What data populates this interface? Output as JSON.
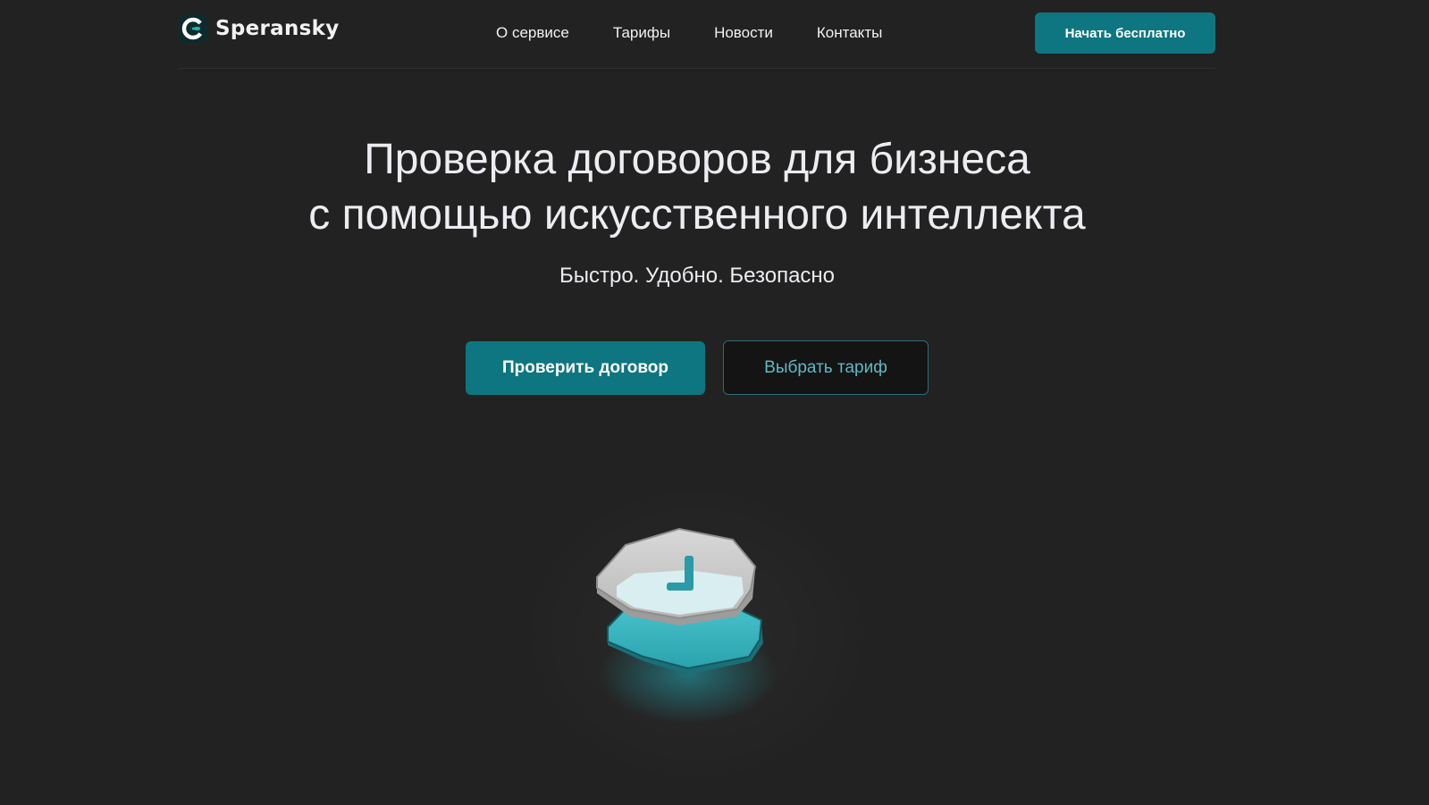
{
  "header": {
    "logo_text": "Speransky",
    "nav": [
      {
        "label": "О сервисе"
      },
      {
        "label": "Тарифы"
      },
      {
        "label": "Новости"
      },
      {
        "label": "Контакты"
      }
    ],
    "cta_label": "Начать бесплатно"
  },
  "hero": {
    "title_line1": "Проверка договоров для бизнеса",
    "title_line2": "с помощью искусственного интеллекта",
    "subtitle": "Быстро. Удобно. Безопасно",
    "primary_label": "Проверить договор",
    "secondary_label": "Выбрать тариф"
  },
  "colors": {
    "background": "#222222",
    "accent": "#0e7681",
    "accent_light": "#5fb9c2",
    "text": "#ececf1"
  },
  "icons": {
    "logo": "c-logo-icon",
    "illustration": "clock-shield-illustration"
  }
}
